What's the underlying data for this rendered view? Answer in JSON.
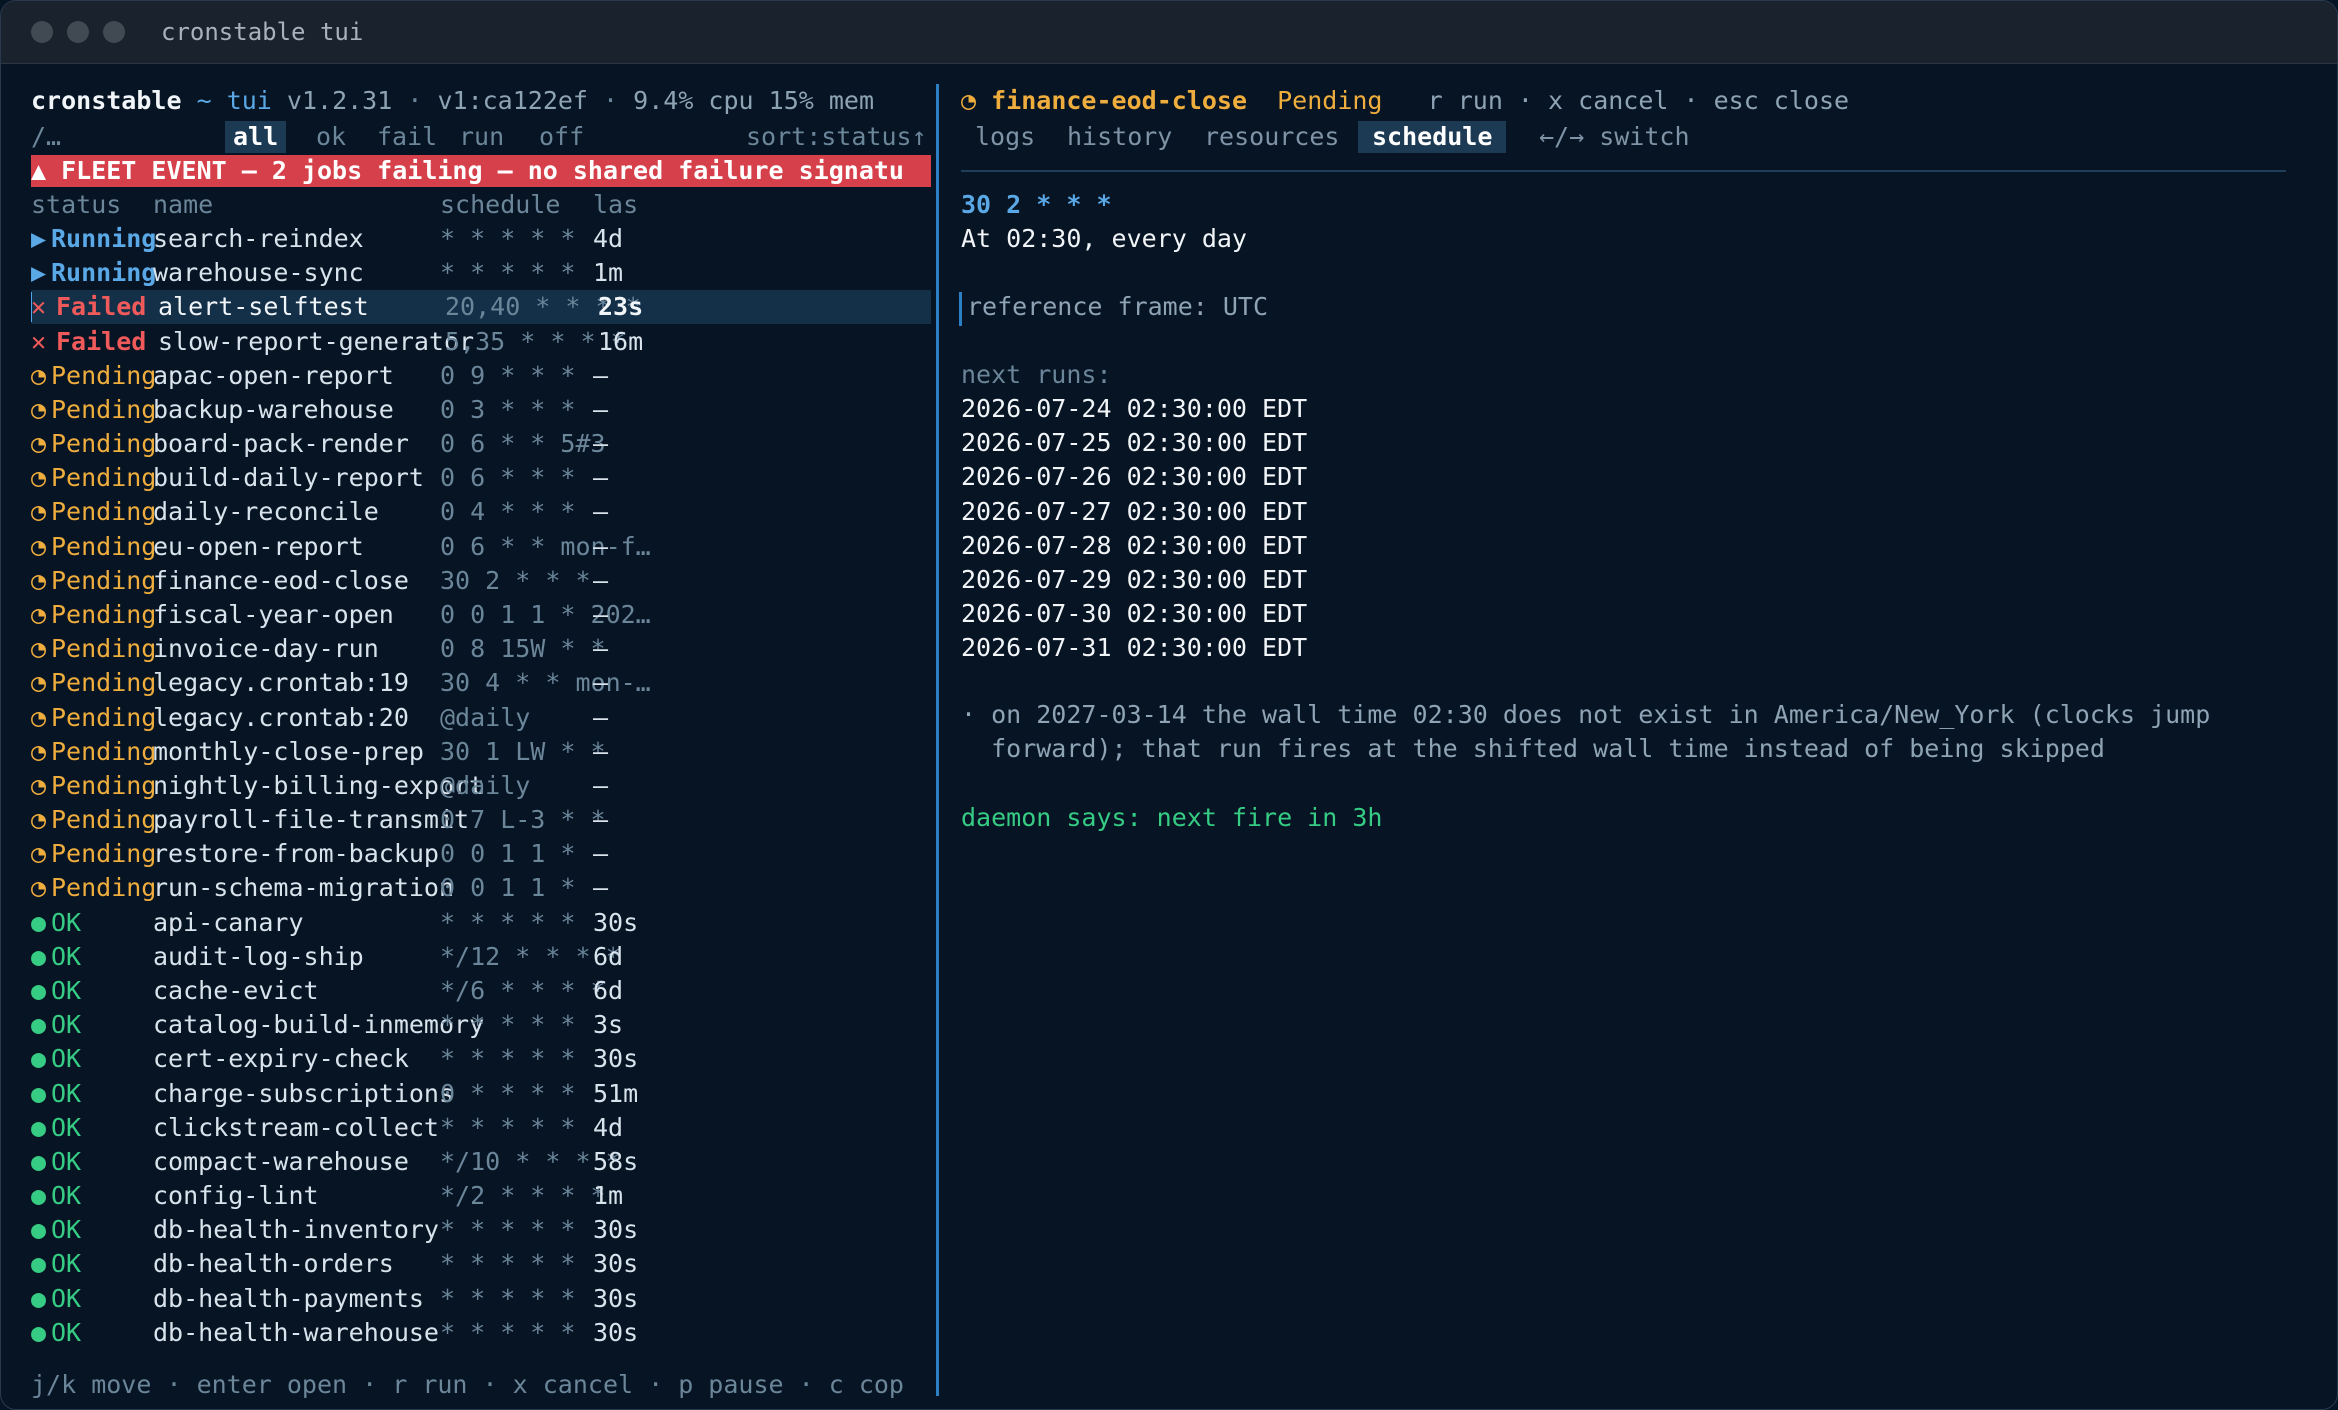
{
  "window": {
    "title": "cronstable tui"
  },
  "header": {
    "app": "cronstable",
    "sep": "~",
    "subtitle": "tui",
    "version": "v1.2.31",
    "dot1": "·",
    "build": "v1:ca122ef",
    "dot2": "·",
    "cpu": "9.4% cpu",
    "mem": "15% mem"
  },
  "search": {
    "prompt": "/…"
  },
  "filters": [
    {
      "label": "all",
      "active": true
    },
    {
      "label": "ok"
    },
    {
      "label": "fail"
    },
    {
      "label": "run"
    },
    {
      "label": "off"
    }
  ],
  "sort": "sort:status↑",
  "banner": "▲ FLEET EVENT — 2 jobs failing — no shared failure signatu",
  "columns": {
    "status": "status",
    "name": "name",
    "schedule": "schedule",
    "last": "las"
  },
  "jobs": [
    {
      "icon": "▶",
      "status": "Running",
      "name": "search-reindex",
      "schedule": "* * * * *",
      "last": "4d",
      "kind": "running"
    },
    {
      "icon": "▶",
      "status": "Running",
      "name": "warehouse-sync",
      "schedule": "* * * * *",
      "last": "1m",
      "kind": "running"
    },
    {
      "icon": "✕",
      "status": "Failed",
      "name": "alert-selftest",
      "schedule": "20,40 * * * *",
      "last": "23s",
      "kind": "failed",
      "selected": true
    },
    {
      "icon": "✕",
      "status": "Failed",
      "name": "slow-report-generator",
      "schedule": "5,35 * * * *",
      "last": "16m",
      "kind": "failed"
    },
    {
      "icon": "◔",
      "status": "Pending",
      "name": "apac-open-report",
      "schedule": "0 9 * * *",
      "last": "—",
      "kind": "pending"
    },
    {
      "icon": "◔",
      "status": "Pending",
      "name": "backup-warehouse",
      "schedule": "0 3 * * *",
      "last": "—",
      "kind": "pending"
    },
    {
      "icon": "◔",
      "status": "Pending",
      "name": "board-pack-render",
      "schedule": "0 6 * * 5#3",
      "last": "—",
      "kind": "pending"
    },
    {
      "icon": "◔",
      "status": "Pending",
      "name": "build-daily-report",
      "schedule": "0 6 * * *",
      "last": "—",
      "kind": "pending"
    },
    {
      "icon": "◔",
      "status": "Pending",
      "name": "daily-reconcile",
      "schedule": "0 4 * * *",
      "last": "—",
      "kind": "pending"
    },
    {
      "icon": "◔",
      "status": "Pending",
      "name": "eu-open-report",
      "schedule": "0 6 * * mon-f…",
      "last": "—",
      "kind": "pending"
    },
    {
      "icon": "◔",
      "status": "Pending",
      "name": "finance-eod-close",
      "schedule": "30 2 * * *",
      "last": "—",
      "kind": "pending"
    },
    {
      "icon": "◔",
      "status": "Pending",
      "name": "fiscal-year-open",
      "schedule": "0 0 1 1 * 202…",
      "last": "—",
      "kind": "pending"
    },
    {
      "icon": "◔",
      "status": "Pending",
      "name": "invoice-day-run",
      "schedule": "0 8 15W * *",
      "last": "—",
      "kind": "pending"
    },
    {
      "icon": "◔",
      "status": "Pending",
      "name": "legacy.crontab:19",
      "schedule": "30 4 * * mon-…",
      "last": "—",
      "kind": "pending"
    },
    {
      "icon": "◔",
      "status": "Pending",
      "name": "legacy.crontab:20",
      "schedule": "@daily",
      "last": "—",
      "kind": "pending"
    },
    {
      "icon": "◔",
      "status": "Pending",
      "name": "monthly-close-prep",
      "schedule": "30 1 LW * *",
      "last": "—",
      "kind": "pending"
    },
    {
      "icon": "◔",
      "status": "Pending",
      "name": "nightly-billing-export",
      "schedule": "@daily",
      "last": "—",
      "kind": "pending"
    },
    {
      "icon": "◔",
      "status": "Pending",
      "name": "payroll-file-transmit",
      "schedule": "0 7 L-3 * *",
      "last": "—",
      "kind": "pending"
    },
    {
      "icon": "◔",
      "status": "Pending",
      "name": "restore-from-backup",
      "schedule": "0 0 1 1 *",
      "last": "—",
      "kind": "pending"
    },
    {
      "icon": "◔",
      "status": "Pending",
      "name": "run-schema-migration",
      "schedule": "0 0 1 1 *",
      "last": "—",
      "kind": "pending"
    },
    {
      "icon": "●",
      "status": "OK",
      "name": "api-canary",
      "schedule": "* * * * *",
      "last": "30s",
      "kind": "ok"
    },
    {
      "icon": "●",
      "status": "OK",
      "name": "audit-log-ship",
      "schedule": "*/12 * * * *",
      "last": "6d",
      "kind": "ok"
    },
    {
      "icon": "●",
      "status": "OK",
      "name": "cache-evict",
      "schedule": "*/6 * * * *",
      "last": "6d",
      "kind": "ok"
    },
    {
      "icon": "●",
      "status": "OK",
      "name": "catalog-build-inmemory",
      "schedule": "* * * * *",
      "last": "3s",
      "kind": "ok"
    },
    {
      "icon": "●",
      "status": "OK",
      "name": "cert-expiry-check",
      "schedule": "* * * * *",
      "last": "30s",
      "kind": "ok"
    },
    {
      "icon": "●",
      "status": "OK",
      "name": "charge-subscriptions",
      "schedule": "0 * * * *",
      "last": "51m",
      "kind": "ok"
    },
    {
      "icon": "●",
      "status": "OK",
      "name": "clickstream-collect",
      "schedule": "* * * * *",
      "last": "4d",
      "kind": "ok"
    },
    {
      "icon": "●",
      "status": "OK",
      "name": "compact-warehouse",
      "schedule": "*/10 * * * *",
      "last": "58s",
      "kind": "ok"
    },
    {
      "icon": "●",
      "status": "OK",
      "name": "config-lint",
      "schedule": "*/2 * * * *",
      "last": "1m",
      "kind": "ok"
    },
    {
      "icon": "●",
      "status": "OK",
      "name": "db-health-inventory",
      "schedule": "* * * * *",
      "last": "30s",
      "kind": "ok"
    },
    {
      "icon": "●",
      "status": "OK",
      "name": "db-health-orders",
      "schedule": "* * * * *",
      "last": "30s",
      "kind": "ok"
    },
    {
      "icon": "●",
      "status": "OK",
      "name": "db-health-payments",
      "schedule": "* * * * *",
      "last": "30s",
      "kind": "ok"
    },
    {
      "icon": "●",
      "status": "OK",
      "name": "db-health-warehouse",
      "schedule": "* * * * *",
      "last": "30s",
      "kind": "ok"
    }
  ],
  "footer": "j/k move · enter open · r run · x cancel · p pause · c cop",
  "detail": {
    "icon": "◔",
    "job": "finance-eod-close",
    "status": "Pending",
    "keys": "r run · x cancel · esc close",
    "tabs": [
      {
        "label": "logs"
      },
      {
        "label": "history"
      },
      {
        "label": "resources"
      },
      {
        "label": "schedule",
        "active": true
      }
    ],
    "switch_hint": "←/→ switch",
    "cron": "30 2 * * *",
    "human": "At 02:30, every day",
    "reference": "reference frame: UTC",
    "next_runs_label": "next runs:",
    "next_runs": [
      "2026-07-24 02:30:00 EDT",
      "2026-07-25 02:30:00 EDT",
      "2026-07-26 02:30:00 EDT",
      "2026-07-27 02:30:00 EDT",
      "2026-07-28 02:30:00 EDT",
      "2026-07-29 02:30:00 EDT",
      "2026-07-30 02:30:00 EDT",
      "2026-07-31 02:30:00 EDT"
    ],
    "dst_note_1": "· on 2027-03-14 the wall time 02:30 does not exist in America/New_York (clocks jump",
    "dst_note_2": "  forward); that run fires at the shifted wall time instead of being skipped",
    "daemon": "daemon says: next fire in 3h"
  },
  "colors": {
    "running": "#5ba8e6",
    "failed": "#f05a5a",
    "pending": "#efad3d",
    "ok": "#36cc84",
    "accent": "#2c7fc2"
  }
}
